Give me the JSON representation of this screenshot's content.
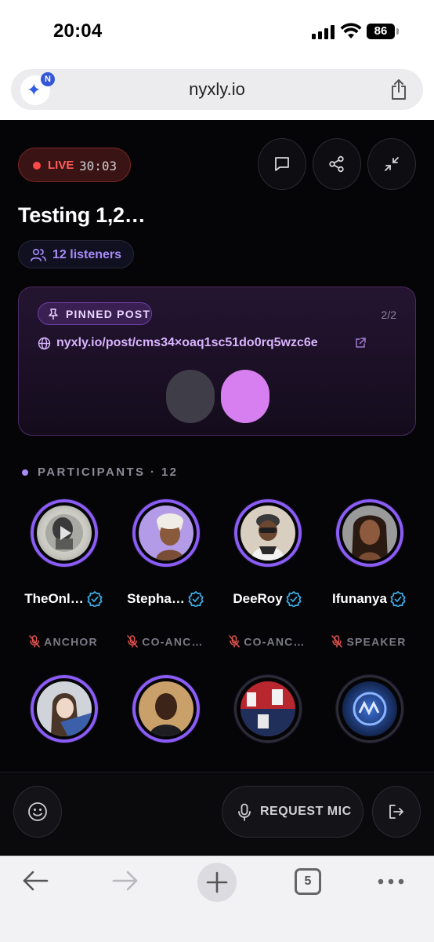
{
  "status_bar": {
    "time": "20:04",
    "battery": "86"
  },
  "browser": {
    "url": "nyxly.io",
    "badge_letter": "N",
    "tab_count": "5"
  },
  "room": {
    "live_label": "LIVE",
    "timer": "30:03",
    "title": "Testing 1,2…",
    "listeners": "12 listeners"
  },
  "pinned": {
    "badge": "PINNED POST",
    "count": "2/2",
    "link": "nyxly.io/post/cms34×oaq1sc51do0rq5wzc6e"
  },
  "participants": {
    "header": "PARTICIPANTS · 12",
    "items": [
      {
        "name": "TheOnl…",
        "role": "ANCHOR",
        "verified": true
      },
      {
        "name": "Stepha…",
        "role": "CO-ANC…",
        "verified": true
      },
      {
        "name": "DeeRoy",
        "role": "CO-ANC…",
        "verified": true
      },
      {
        "name": "Ifunanya",
        "role": "SPEAKER",
        "verified": true
      }
    ]
  },
  "actions": {
    "request_mic": "REQUEST MIC"
  },
  "colors": {
    "accent": "#8b5cf6",
    "live": "#ff4747",
    "verified": "#3ba7e0"
  }
}
